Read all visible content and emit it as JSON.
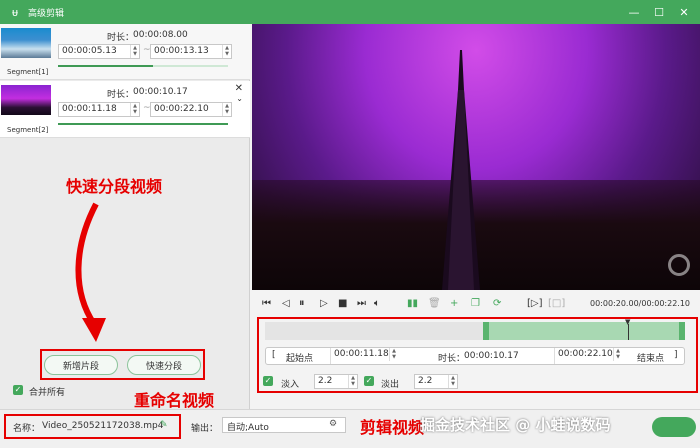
{
  "window": {
    "title": "高级剪辑",
    "controls": [
      "—",
      "☐",
      "✕"
    ]
  },
  "segments": [
    {
      "label": "Segment[1]",
      "duration_label": "时长：",
      "duration": "00:00:08.00",
      "start": "00:00:05.13",
      "end": "00:00:13.13"
    },
    {
      "label": "Segment[2]",
      "duration_label": "时长：",
      "duration": "00:00:10.17",
      "start": "00:00:11.18",
      "end": "00:00:22.10"
    }
  ],
  "annotations": {
    "quick_split": "快速分段视频",
    "rename": "重命名视频",
    "edit": "剪辑视频"
  },
  "buttons": {
    "add_segment": "新增片段",
    "quick_split": "快速分段",
    "merge_all": "合并所有"
  },
  "player": {
    "time_display": "00:00:20.00/00:00:22.10"
  },
  "trim": {
    "start_label": "起始点",
    "start": "00:00:11.18",
    "duration_label": "时长：",
    "duration": "00:00:10.17",
    "end": "00:00:22.10",
    "end_label": "结束点",
    "fade_in_label": "淡入",
    "fade_in": "2.2",
    "fade_out_label": "淡出",
    "fade_out": "2.2"
  },
  "output": {
    "name_label": "名称：",
    "name": "Video_250521172038.mp4",
    "output_label": "输出：",
    "output_value": "自动;Auto"
  },
  "watermark": "掘金技术社区 @ 小蛙说数码",
  "colors": {
    "accent": "#44a85c",
    "annotation": "#e60000"
  }
}
